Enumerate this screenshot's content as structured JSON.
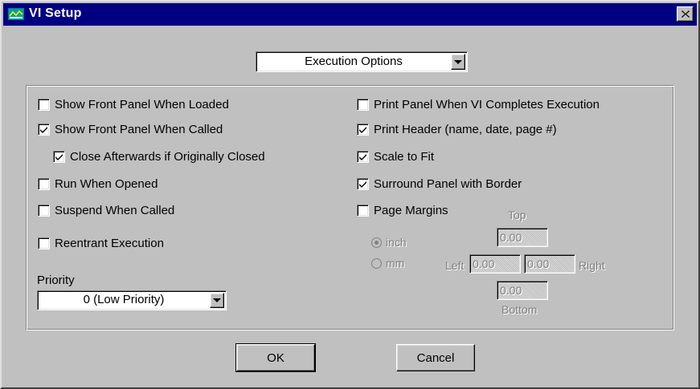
{
  "window": {
    "title": "VI Setup",
    "close_glyph": "×"
  },
  "category_select": {
    "value": "Execution Options"
  },
  "left_options": [
    {
      "label": "Show Front Panel When Loaded",
      "checked": false
    },
    {
      "label": "Show Front Panel When Called",
      "checked": true
    },
    {
      "label": "Close Afterwards if Originally Closed",
      "checked": true
    },
    {
      "label": "Run When Opened",
      "checked": false
    },
    {
      "label": "Suspend When Called",
      "checked": false
    },
    {
      "label": "Reentrant Execution",
      "checked": false
    }
  ],
  "priority": {
    "label": "Priority",
    "value": "0 (Low Priority)"
  },
  "right_options": [
    {
      "label": "Print Panel When VI Completes Execution",
      "checked": false
    },
    {
      "label": "Print Header (name, date, page #)",
      "checked": true
    },
    {
      "label": "Scale to Fit",
      "checked": true
    },
    {
      "label": "Surround Panel with Border",
      "checked": true
    },
    {
      "label": "Page Margins",
      "checked": false
    }
  ],
  "margins": {
    "units": [
      {
        "label": "inch",
        "selected": true
      },
      {
        "label": "mm",
        "selected": false
      }
    ],
    "top_label": "Top",
    "top_value": "0.00",
    "left_label": "Left",
    "left_value": "0.00",
    "right_label": "Right",
    "right_value": "0.00",
    "bottom_label": "Bottom",
    "bottom_value": "0.00"
  },
  "buttons": {
    "ok": "OK",
    "cancel": "Cancel"
  },
  "colors": {
    "titlebar": "#000080",
    "face": "#c0c0c0"
  }
}
